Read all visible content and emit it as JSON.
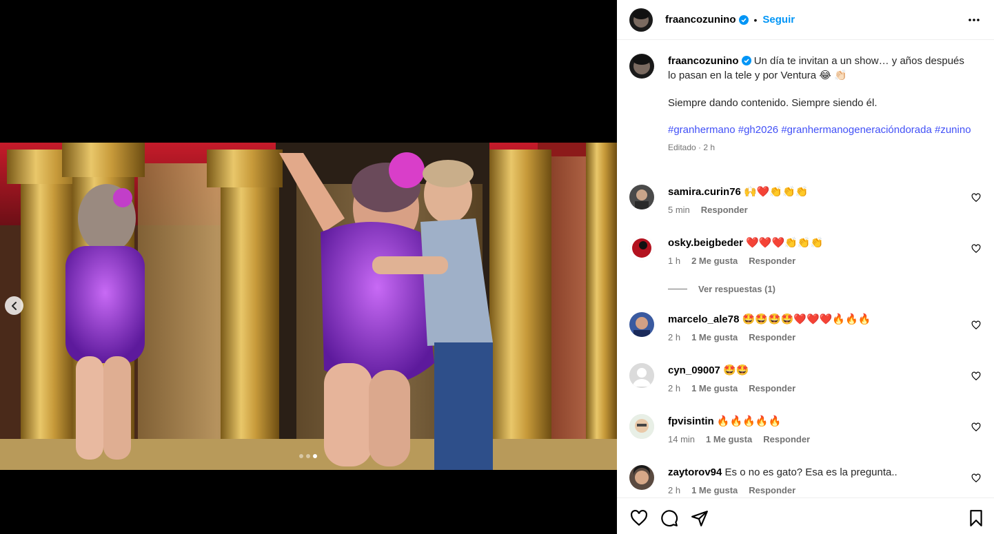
{
  "media": {
    "carousel_dots": 3,
    "active_dot": 3
  },
  "post": {
    "username": "fraancozunino",
    "follow_label": "Seguir",
    "separator": "•"
  },
  "caption": {
    "username": "fraancozunino",
    "text1": "Un día te invitan a un show… y años después lo pasan en la tele y por Ventura 😂 👏🏻",
    "text2": "Siempre dando contenido. Siempre siendo él.",
    "hashtags": [
      "#granhermano",
      "#gh2026",
      "#granhermanogeneracióndorada",
      "#zunino"
    ],
    "meta": "Editado · 2 h"
  },
  "comments": [
    {
      "username": "samira.curin76",
      "text": "🙌❤️👏👏👏",
      "time": "5 min",
      "likes": "",
      "reply": "Responder"
    },
    {
      "username": "osky.beigbeder",
      "text": "❤️❤️❤️👏👏👏",
      "time": "1 h",
      "likes": "2 Me gusta",
      "reply": "Responder",
      "replies": "Ver respuestas (1)"
    },
    {
      "username": "marcelo_ale78",
      "text": "🤩🤩🤩🤩❤️❤️❤️🔥🔥🔥",
      "time": "2 h",
      "likes": "1 Me gusta",
      "reply": "Responder"
    },
    {
      "username": "cyn_09007",
      "text": "🤩🤩",
      "time": "2 h",
      "likes": "1 Me gusta",
      "reply": "Responder"
    },
    {
      "username": "fpvisintin",
      "text": "🔥🔥🔥🔥🔥",
      "time": "14 min",
      "likes": "1 Me gusta",
      "reply": "Responder"
    },
    {
      "username": "zaytorov94",
      "text": "Es o no es gato? Esa es la pregunta..",
      "time": "2 h",
      "likes": "1 Me gusta",
      "reply": "Responder"
    }
  ],
  "colors": {
    "accent": "#0095f6",
    "hashtag": "#4150f7",
    "muted": "#737373"
  },
  "icons": [
    "chevron-left-icon",
    "verified-badge-icon",
    "more-options-icon",
    "heart-icon",
    "comment-icon",
    "share-icon",
    "bookmark-icon"
  ]
}
